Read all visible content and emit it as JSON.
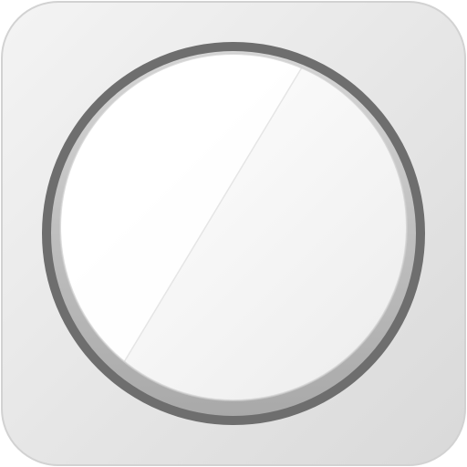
{
  "app_icon": {
    "icon": "flashlight-button-icon",
    "colors": {
      "tile_light": "#f4f4f4",
      "tile_dark": "#d9d9d9",
      "ring_outer": "#6e6e6e",
      "ring_inner": "#bdbdbd",
      "face_light": "#ffffff",
      "face_dark": "#eeeeee"
    }
  }
}
